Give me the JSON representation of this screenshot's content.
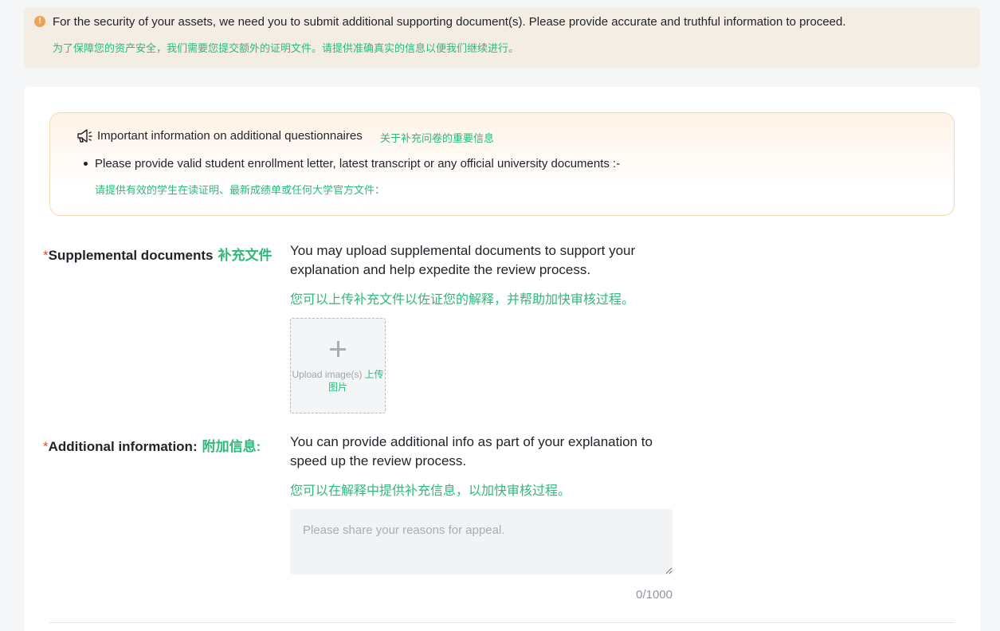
{
  "alert": {
    "message_en": "For the security of your assets, we need you to submit additional supporting document(s). Please provide accurate and truthful information to proceed.",
    "message_cn": "为了保障您的资产安全，我们需要您提交额外的证明文件。请提供准确真实的信息以便我们继续进行。",
    "icon": "exclamation-icon",
    "color": "#f0a252"
  },
  "info_box": {
    "title_en": "Important information on additional questionnaires",
    "title_cn": "关于补充问卷的重要信息",
    "icon": "megaphone-icon",
    "items": [
      {
        "text_en": "Please provide valid student enrollment letter, latest transcript or any official university documents :-",
        "text_cn": "请提供有效的学生在读证明、最新成绩单或任何大学官方文件："
      }
    ]
  },
  "supplemental": {
    "required_mark": "*",
    "label_en": "Supplemental documents",
    "label_cn": "补充文件",
    "desc_en": "You may upload supplemental documents to support your explanation and help expedite the review process.",
    "desc_cn": "您可以上传补充文件以佐证您的解释，并帮助加快审核过程。",
    "upload_label_en": "Upload image(s)",
    "upload_label_cn": "上传图片",
    "upload_icon": "plus-icon"
  },
  "additional": {
    "required_mark": "*",
    "label_en": "Additional information:",
    "label_cn": "附加信息:",
    "desc_en": "You can provide additional info as part of your explanation to speed up the review process.",
    "desc_cn": "您可以在解释中提供补充信息，以加快审核过程。",
    "placeholder": "Please share your reasons for appeal.",
    "value": "",
    "char_count": "0/1000"
  },
  "colors": {
    "accent_green": "#2db97a",
    "required_red": "#e8483e",
    "warning_orange": "#f0a252"
  }
}
